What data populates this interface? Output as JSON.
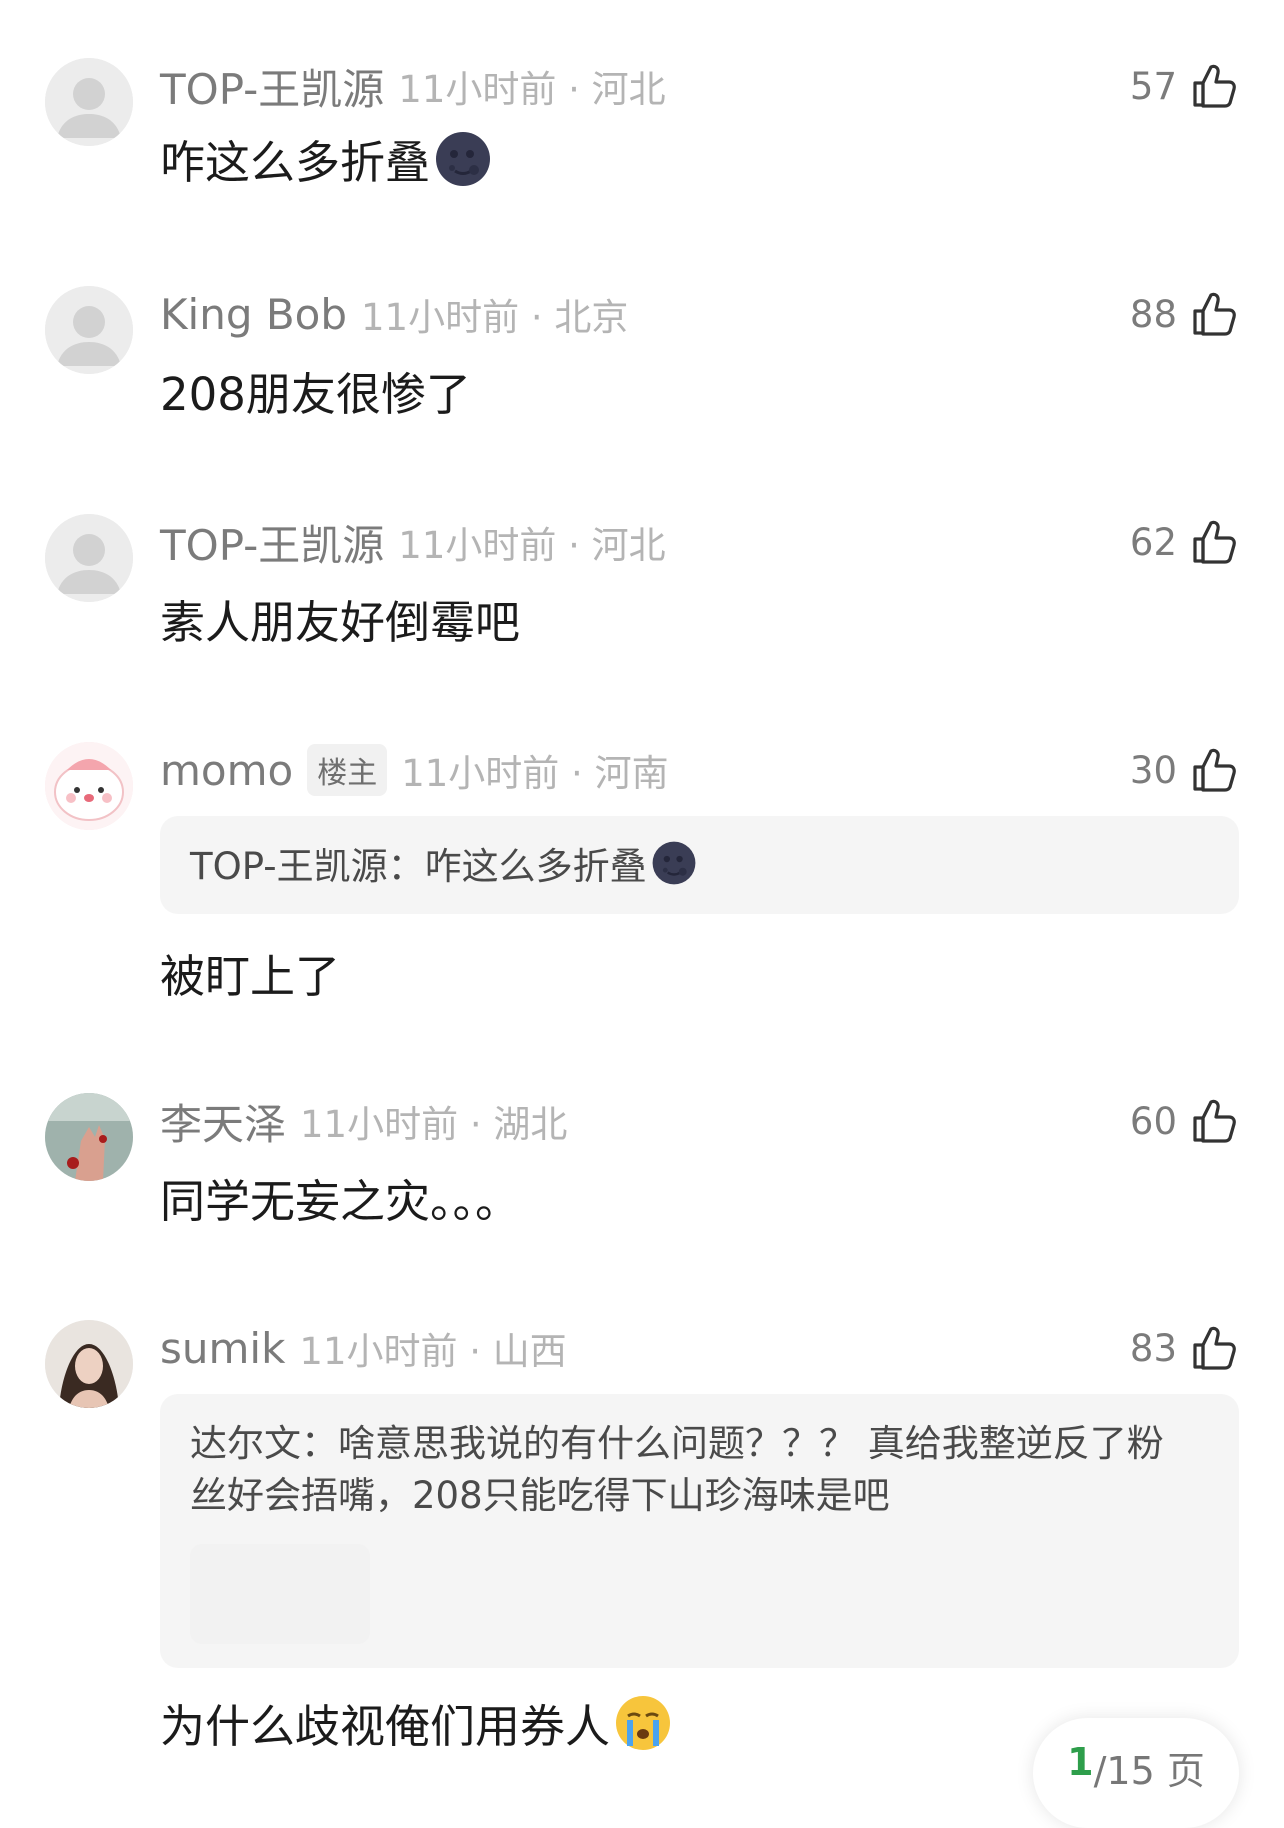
{
  "colors": {
    "username": "#7b7b7b",
    "meta_time": "#b4b4b4",
    "text": "#1b1b1b",
    "quote_bg": "#f5f5f5",
    "page_current": "#2e9e4b"
  },
  "comments": [
    {
      "user": "TOP-王凯源",
      "time": "11小时前 · 河北",
      "likes": "57",
      "text": "咋这么多折叠",
      "emoji": "new-moon-face-emoji",
      "avatar": "default-avatar"
    },
    {
      "user": "King Bob",
      "time": "11小时前 · 北京",
      "likes": "88",
      "text": "208朋友很惨了",
      "avatar": "default-avatar"
    },
    {
      "user": "TOP-王凯源",
      "time": "11小时前 · 河北",
      "likes": "62",
      "text": "素人朋友好倒霉吧",
      "avatar": "default-avatar"
    },
    {
      "user": "momo",
      "tag": "楼主",
      "time": "11小时前 · 河南",
      "likes": "30",
      "quote": "TOP-王凯源：咋这么多折叠",
      "quote_emoji": "new-moon-face-emoji",
      "text": "被盯上了",
      "avatar": "cartoon-avatar"
    },
    {
      "user": "李天泽",
      "time": "11小时前 · 湖北",
      "likes": "60",
      "text": "同学无妄之灾。。。",
      "avatar": "photo-avatar"
    },
    {
      "user": "sumik",
      "time": "11小时前 · 山西",
      "likes": "83",
      "quote_line1": "达尔文：啥意思我说的有什么问题？？？ 真给我整逆反了粉",
      "quote_line2": "丝好会捂嘴，208只能吃得下山珍海味是吧",
      "text": "为什么歧视俺们用券人",
      "emoji": "crying-face-emoji",
      "avatar": "photo-avatar"
    }
  ],
  "pagination": {
    "current": "1",
    "total": "/15 页"
  }
}
